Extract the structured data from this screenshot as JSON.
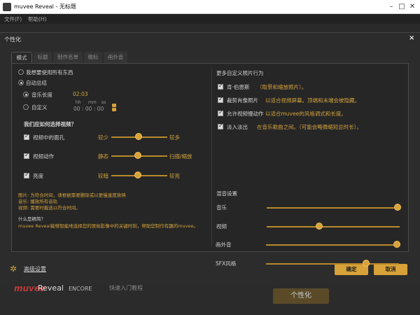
{
  "window": {
    "title": "muvee Reveal - 无标题",
    "menus": [
      "文件(F)",
      "帮助(H)"
    ]
  },
  "dialog": {
    "title": "个性化",
    "close": "×",
    "tabs": [
      "模式",
      "标题",
      "制作名单",
      "徽标",
      "画外音"
    ],
    "active_tab": 0,
    "mode": {
      "option_all": "我想要使用所有东西",
      "option_total": "自动总结",
      "music_length_label": "音乐长度",
      "music_length_value": "02:03",
      "custom_label": "自定义",
      "time_headers": [
        "hh",
        "mm",
        "ss"
      ],
      "time_value": "00 : 00 : 00"
    },
    "select_heading": "我们应如何选择视频？",
    "video_options": [
      {
        "label": "视频中的面孔",
        "left": "较少",
        "right": "较多",
        "level": 0.5
      },
      {
        "label": "视频动作",
        "left": "静态",
        "right": "扫描/缩放",
        "level": 0.48
      },
      {
        "label": "亮度",
        "left": "较暗",
        "right": "较亮",
        "level": 0.45
      }
    ],
    "notes": [
      "图片:    为符合时间，请根据需要删除或以更慢速度放映",
      "音乐:    播放所有音轨",
      "视频:    需要时截选以符合时间。"
    ],
    "what_is": "什么是精简？",
    "what_is_desc": "muvee Reveal能够智能地选择您的原始影像中的关键时刻，帮助您制作有趣的muvee。",
    "more_heading": "更多自定义照片行为",
    "photo_options": [
      {
        "label": "肯·伯恩斯",
        "desc": "（取景和缩放照片）。"
      },
      {
        "label": "裁剪肖像照片",
        "desc": "以适合视频屏幕。顶端和末端会被隐藏。"
      },
      {
        "label": "允许视频慢动作",
        "desc": "以适合muvee的风格调式和长度。"
      },
      {
        "label": "淡入淡出",
        "desc": "在音乐歌曲之间。（可能会略微缩短总时长）。"
      }
    ],
    "mix_heading": "混音设置",
    "mix": [
      {
        "label": "音乐",
        "level": 1.0
      },
      {
        "label": "视频",
        "level": 0.4
      },
      {
        "label": "画外音",
        "level": 1.0
      },
      {
        "label": "SFX风格",
        "level": 0.75
      }
    ],
    "advanced": "高级设置",
    "ok": "确定",
    "cancel": "取消"
  },
  "footer": {
    "brand_a": "muvee",
    "brand_b": "Reveal",
    "brand_c": "ENCORE",
    "tutorial": "快速入门教程",
    "personalize": "个性化"
  },
  "colors": {
    "accent": "#d8a23a",
    "panel": "#262626",
    "bg": "#2c2c2c"
  }
}
